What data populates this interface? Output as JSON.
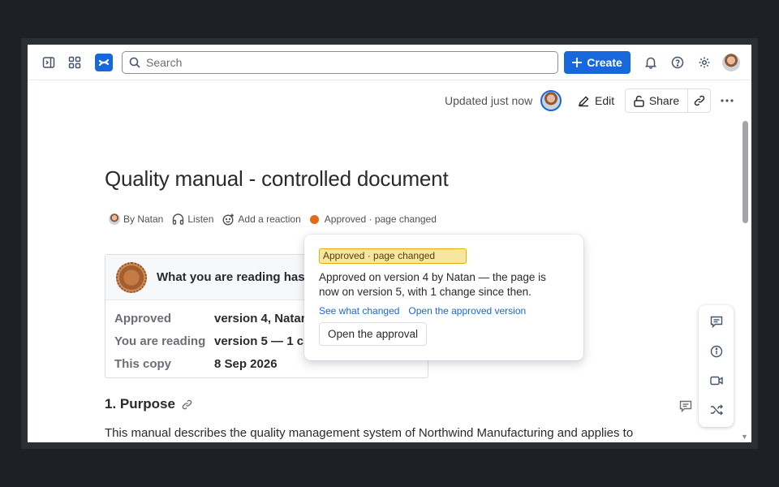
{
  "topbar": {
    "search_placeholder": "Search",
    "create_label": "Create",
    "icons": [
      "sidebar-toggle-icon",
      "app-switcher-icon",
      "confluence-logo-icon",
      "search-icon",
      "plus-icon",
      "bell-icon",
      "help-icon",
      "gear-icon"
    ]
  },
  "page_actions": {
    "updated": "Updated just now",
    "edit_label": "Edit",
    "share_label": "Share"
  },
  "page": {
    "title": "Quality manual - controlled document",
    "byline": {
      "author": "By Natan",
      "listen": "Listen",
      "reaction": "Add a reaction",
      "status": "Approved · page changed",
      "status_color": "#e06c1a"
    }
  },
  "panel": {
    "heading": "What you are reading has b",
    "rows": [
      {
        "key": "Approved",
        "value": "version 4, Natan"
      },
      {
        "key": "You are reading",
        "value": "version 5 — 1 ch"
      },
      {
        "key": "This copy",
        "value": "8 Sep 2026"
      }
    ]
  },
  "popover": {
    "lozenge": "Approved · page changed",
    "text": "Approved on version 4 by Natan — the page is now on version 5, with 1 change since then.",
    "link1": "See what changed",
    "link2": "Open the approved version",
    "button": "Open the approval"
  },
  "content": {
    "heading": "1. Purpose",
    "paragraph": "This manual describes the quality management system of Northwind Manufacturing and applies to"
  },
  "rail": {
    "icons": [
      "comment-icon",
      "info-icon",
      "video-icon",
      "shuffle-icon"
    ]
  },
  "colors": {
    "accent": "#1868db",
    "status_orange": "#e06c1a",
    "lozenge_bg": "#f8e6a0"
  }
}
